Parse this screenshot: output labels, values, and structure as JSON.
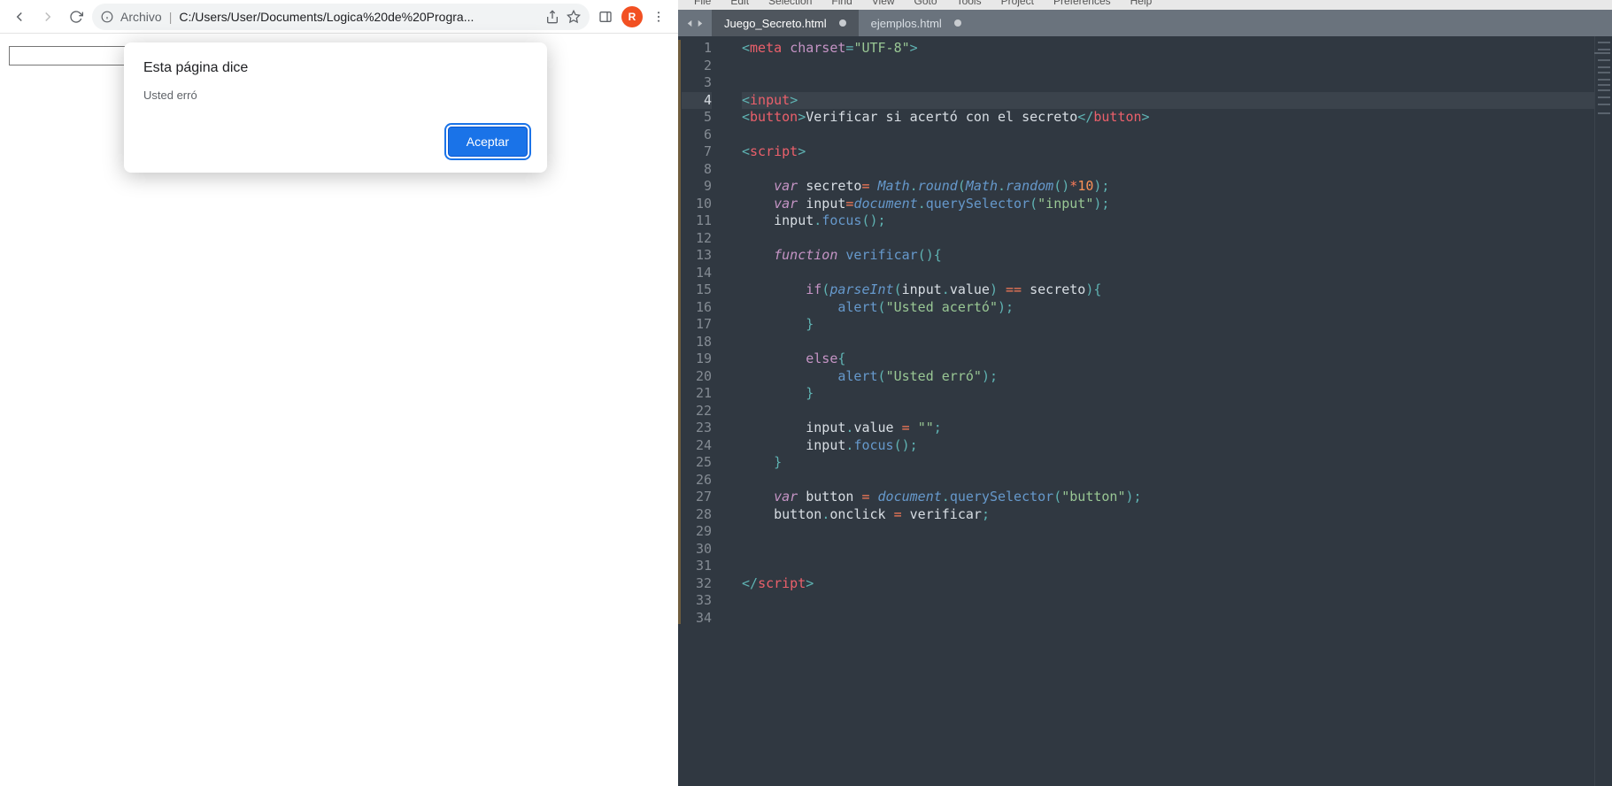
{
  "chrome": {
    "omnibox_label": "Archivo",
    "omnibox_url": "C:/Users/User/Documents/Logica%20de%20Progra...",
    "avatar_letter": "R"
  },
  "dialog": {
    "title": "Esta página dice",
    "message": "Usted erró",
    "accept": "Aceptar"
  },
  "sublime": {
    "menu": [
      "File",
      "Edit",
      "Selection",
      "Find",
      "View",
      "Goto",
      "Tools",
      "Project",
      "Preferences",
      "Help"
    ],
    "tabs": [
      {
        "label": "Juego_Secreto.html",
        "active": true,
        "dirty": true
      },
      {
        "label": "ejemplos.html",
        "active": false,
        "dirty": true
      }
    ],
    "line_numbers": [
      "1",
      "2",
      "3",
      "4",
      "5",
      "6",
      "7",
      "8",
      "9",
      "10",
      "11",
      "12",
      "13",
      "14",
      "15",
      "16",
      "17",
      "18",
      "19",
      "20",
      "21",
      "22",
      "23",
      "24",
      "25",
      "26",
      "27",
      "28",
      "29",
      "30",
      "31",
      "32",
      "33",
      "34"
    ],
    "highlight_line": 4,
    "code_text": {
      "button_text": "Verificar si acertó con el secreto",
      "str_utf8": "\"UTF-8\"",
      "str_input": "\"input\"",
      "str_acerto": "\"Usted acertó\"",
      "str_erro": "\"Usted erró\"",
      "str_empty": "\"\"",
      "str_button": "\"button\"",
      "num_ten": "10"
    }
  }
}
